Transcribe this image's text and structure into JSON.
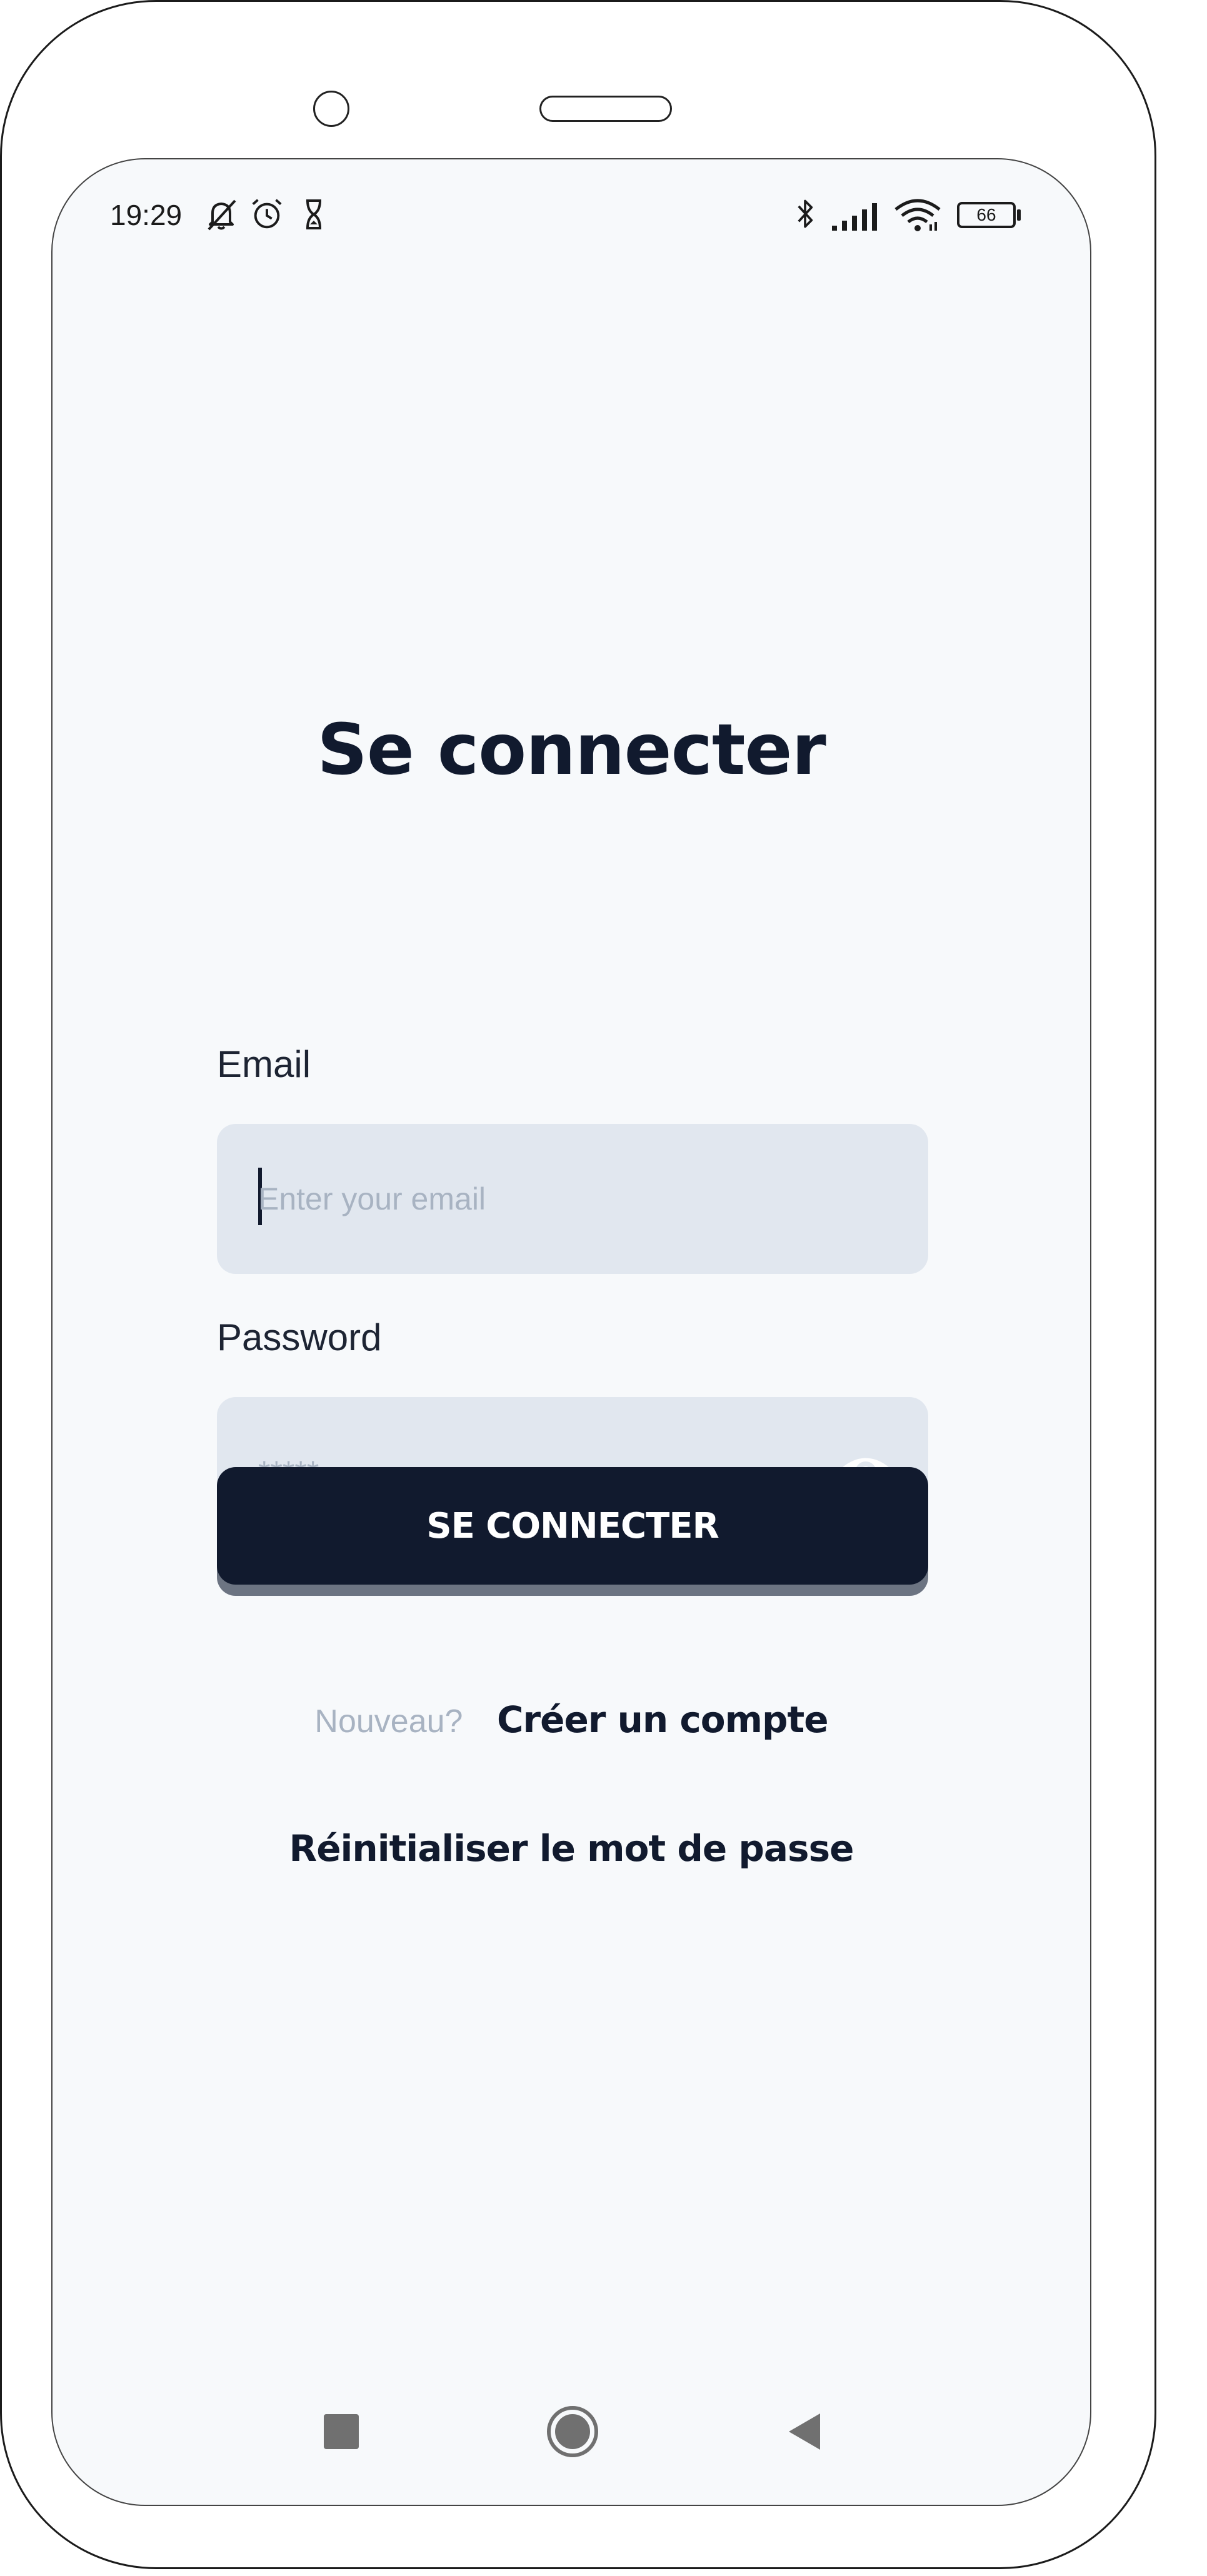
{
  "status_bar": {
    "time": "19:29",
    "battery": "66",
    "left_icons": [
      "bell-off-icon",
      "alarm-icon",
      "hourglass-icon"
    ],
    "right_icons": [
      "bluetooth-icon",
      "signal-icon",
      "wifi-icon",
      "battery-icon"
    ]
  },
  "login": {
    "title": "Se connecter",
    "email_label": "Email",
    "email_placeholder": "Enter your email",
    "password_label": "Password",
    "password_placeholder": "*****",
    "submit_label": "SE CONNECTER",
    "signup_prompt": "Nouveau?",
    "signup_link": "Créer un compte",
    "reset_link": "Réinitialiser le mot de passe"
  },
  "nav_bar": {
    "icons": [
      "recent-apps-icon",
      "home-icon",
      "back-icon"
    ]
  },
  "colors": {
    "primary": "#111a2e",
    "field_bg": "#e1e7ef",
    "screen_bg": "#f7f9fb",
    "muted_text": "#a8b3c2"
  }
}
